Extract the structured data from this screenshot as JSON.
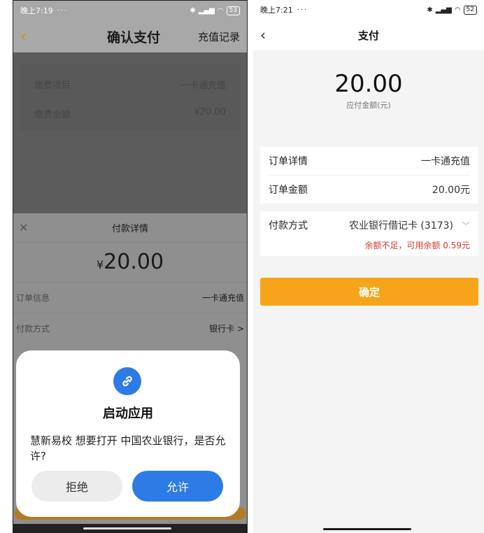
{
  "left": {
    "status": {
      "time": "晚上7:19",
      "dots": "···",
      "battery": "53"
    },
    "header": {
      "back_icon": "chevron-left",
      "title": "确认支付",
      "records_label": "充值记录"
    },
    "info": {
      "item_label": "缴费项目",
      "item_value": "一卡通充值",
      "amount_label": "缴费金额",
      "amount_value": "¥20.00"
    },
    "sheet": {
      "title": "付款详情",
      "currency": "¥",
      "amount": "20.00",
      "rows": [
        {
          "label": "订单信息",
          "value": "一卡通充值"
        },
        {
          "label": "付款方式",
          "value": "银行卡 >"
        }
      ]
    },
    "dialog": {
      "icon": "link-icon",
      "title": "启动应用",
      "message": "慧新易校 想要打开 中国农业银行，是否允许?",
      "deny_label": "拒绝",
      "allow_label": "允许",
      "accent_color": "#2d7be5"
    }
  },
  "right": {
    "status": {
      "time": "晚上7:21",
      "dots": "···",
      "battery": "52"
    },
    "header": {
      "back_icon": "chevron-left",
      "title": "支付"
    },
    "amount": "20.00",
    "amount_label": "应付金额(元)",
    "order": {
      "detail_label": "订单详情",
      "detail_value": "一卡通充值",
      "amount_label": "订单金额",
      "amount_value": "20.00元"
    },
    "payment": {
      "method_label": "付款方式",
      "method_value": "农业银行借记卡 (3173)",
      "warning": "余额不足，可用余额 0.59元",
      "warning_color": "#d23a2f"
    },
    "confirm_label": "确定",
    "confirm_color": "#f6a51b"
  }
}
